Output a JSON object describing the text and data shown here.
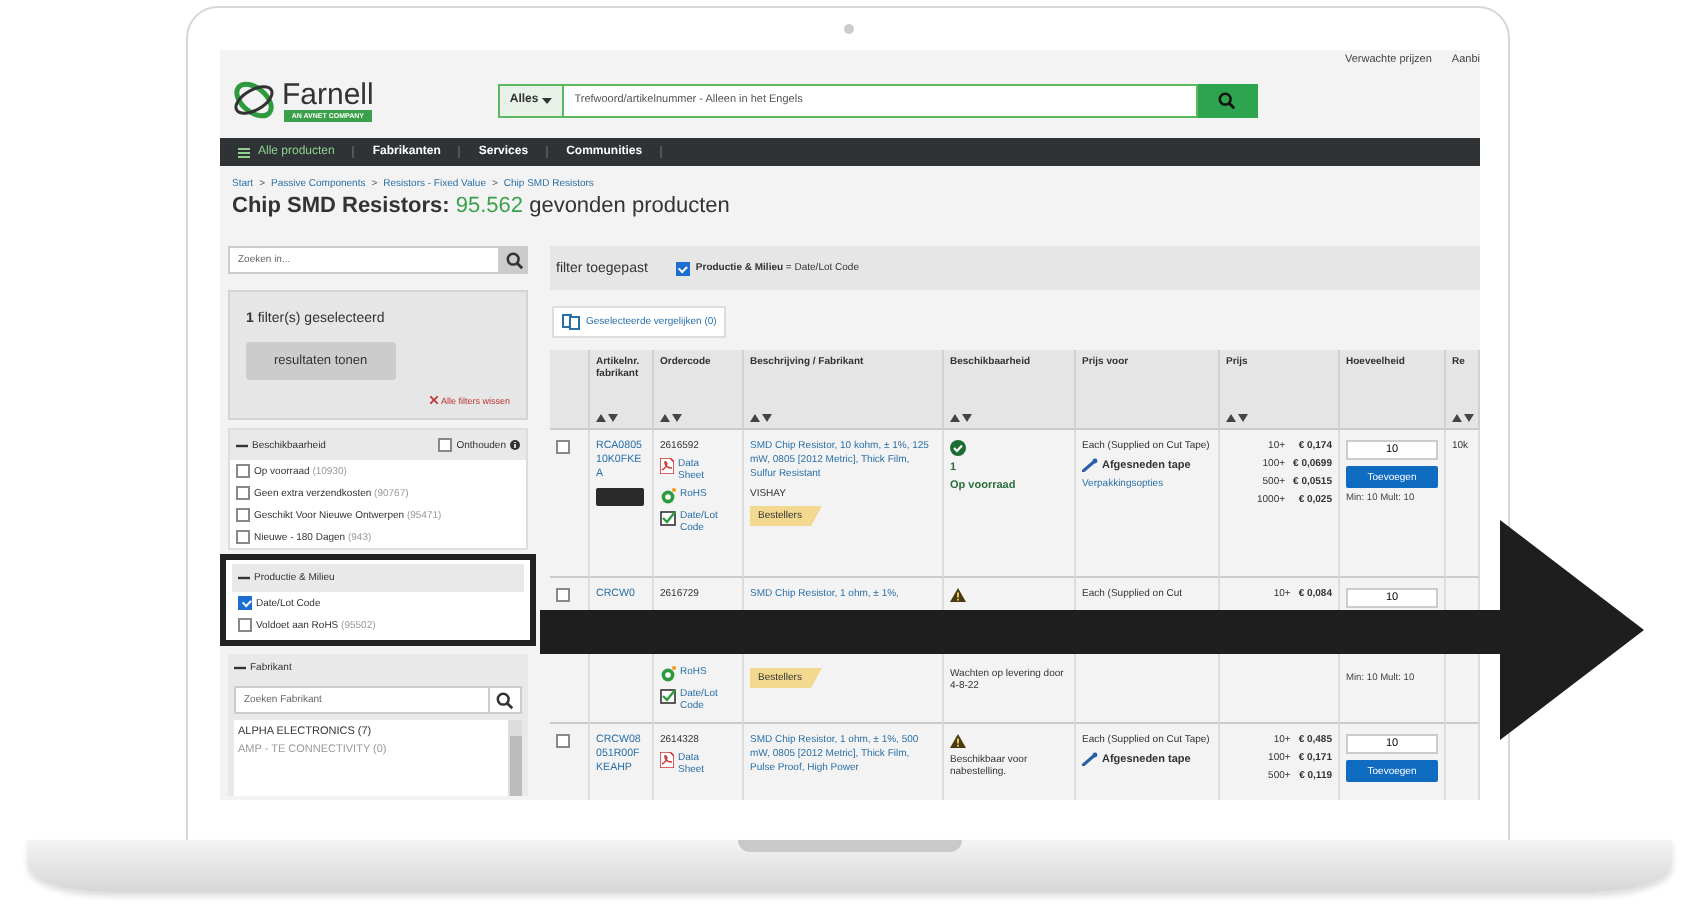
{
  "top_links": [
    "Verwachte prijzen",
    "Aanbi"
  ],
  "logo": {
    "name": "Farnell",
    "tagline": "AN AVNET COMPANY"
  },
  "search": {
    "scope": "Alles",
    "placeholder": "Trefwoord/artikelnummer - Alleen in het Engels"
  },
  "nav": [
    {
      "label": "Alle producten",
      "kind": "menu"
    },
    {
      "label": "Fabrikanten",
      "kind": "link"
    },
    {
      "label": "Services",
      "kind": "link"
    },
    {
      "label": "Communities",
      "kind": "link"
    }
  ],
  "breadcrumb": [
    "Start",
    "Passive Components",
    "Resistors - Fixed Value",
    "Chip SMD Resistors"
  ],
  "breadcrumb_separator": ">",
  "title": {
    "category": "Chip SMD Resistors:",
    "count": "95.562",
    "suffix": "gevonden producten"
  },
  "sidebar": {
    "search_placeholder": "Zoeken in...",
    "selected": "**1** filter(s) geselecteerd",
    "show_button": "resultaten tonen",
    "clear_link": "Alle filters wissen",
    "sections": [
      {
        "title": "Beschikbaarheid",
        "highlighted": false,
        "remember": {
          "label": "Onthouden",
          "checked": false
        },
        "options": [
          {
            "label": "Op voorraad",
            "count": "(10930)",
            "checked": false
          },
          {
            "label": "Geen extra verzendkosten",
            "count": "(90767)",
            "checked": false
          },
          {
            "label": "Geschikt Voor Nieuwe Ontwerpen",
            "count": "(95471)",
            "checked": false
          },
          {
            "label": "Nieuwe - 180 Dagen",
            "count": "(943)",
            "checked": false
          }
        ]
      },
      {
        "title": "Productie & Milieu",
        "highlighted": true,
        "options": [
          {
            "label": "Date/Lot Code",
            "checked": true
          },
          {
            "label": "Voldoet aan RoHS",
            "count": "(95502)",
            "checked": false
          }
        ]
      }
    ],
    "manufacturer": {
      "title": "Fabrikant",
      "placeholder": "Zoeken Fabrikant",
      "items": [
        {
          "label": "ALPHA ELECTRONICS (7)",
          "disabled": false
        },
        {
          "label": "AMP - TE CONNECTIVITY (0)",
          "disabled": true
        }
      ]
    }
  },
  "applied": {
    "title": "filter toegepast",
    "chip": {
      "checked": true,
      "text": "**Productie & Milieu** = Date/Lot Code"
    }
  },
  "compare_button": "Geselecteerde vergelijken (0)",
  "table": {
    "columns": [
      {
        "label": "Artikelnr. fabrikant",
        "sortable": true
      },
      {
        "label": "Ordercode",
        "sortable": true
      },
      {
        "label": "Beschrijving / Fabrikant",
        "sortable": true
      },
      {
        "label": "Beschikbaarheid",
        "sortable": true
      },
      {
        "label": "Prijs voor",
        "sortable": false
      },
      {
        "label": "Prijs",
        "sortable": true
      },
      {
        "label": "Hoeveelheid",
        "sortable": false
      },
      {
        "label": "Re",
        "sortable": true
      }
    ],
    "rows": [
      {
        "kind": "full",
        "checked": false,
        "part_number": "RCA080510K0FKEA",
        "photo": true,
        "order_code": "2616592",
        "docs": [
          {
            "kind": "datasheet",
            "label": "Data Sheet"
          },
          {
            "kind": "rohs",
            "label": "RoHS"
          },
          {
            "kind": "datelot",
            "label": "Date/Lot Code"
          }
        ],
        "description": "SMD Chip Resistor, 10 kohm, ± 1%, 125 mW, 0805 [2012 Metric], Thick Film, Sulfur Resistant",
        "manufacturer": "VISHAY",
        "badge": "Bestellers",
        "availability": {
          "kind": "in_stock",
          "count": "1",
          "text": "Op voorraad"
        },
        "price_for": "Each (Supplied on Cut Tape)",
        "packaging": "Afgesneden tape",
        "options_link": "Verpakkingsopties",
        "prices": [
          {
            "qty": "10+",
            "price": "€ 0,174"
          },
          {
            "qty": "100+",
            "price": "€ 0,0699"
          },
          {
            "qty": "500+",
            "price": "€ 0,0515"
          },
          {
            "qty": "1000+",
            "price": "€ 0,025"
          }
        ],
        "quantity": "10",
        "add_button": "Toevoegen",
        "minmult": "Min: 10 Mult: 10",
        "extra": "10k"
      },
      {
        "kind": "split",
        "checked": false,
        "part_number": "CRCW0",
        "photo": false,
        "order_code": "2616729",
        "docs": [
          {
            "kind": "rohs",
            "label": "RoHS"
          },
          {
            "kind": "datelot",
            "label": "Date/Lot Code"
          }
        ],
        "description": "SMD Chip Resistor, 1 ohm, ± 1%,",
        "badge": "Bestellers",
        "availability": {
          "kind": "warning",
          "text": "Wachten op levering door 4-8-22"
        },
        "price_for": "Each (Supplied on Cut",
        "prices": [
          {
            "qty": "10+",
            "price": "€ 0,084"
          }
        ],
        "quantity": "10",
        "minmult": "Min: 10 Mult: 10"
      },
      {
        "kind": "full",
        "checked": false,
        "part_number": "CRCW08051R00FKEAHP",
        "photo": false,
        "order_code": "2614328",
        "docs": [
          {
            "kind": "datasheet",
            "label": "Data Sheet"
          }
        ],
        "description": "SMD Chip Resistor, 1 ohm, ± 1%, 500 mW, 0805 [2012 Metric], Thick Film, Pulse Proof, High Power",
        "availability": {
          "kind": "warning",
          "text": "Beschikbaar voor nabestelling."
        },
        "price_for": "Each (Supplied on Cut Tape)",
        "packaging": "Afgesneden tape",
        "prices": [
          {
            "qty": "10+",
            "price": "€ 0,485"
          },
          {
            "qty": "100+",
            "price": "€ 0,171"
          },
          {
            "qty": "500+",
            "price": "€ 0,119"
          }
        ],
        "quantity": "10",
        "add_button": "Toevoegen"
      }
    ]
  }
}
